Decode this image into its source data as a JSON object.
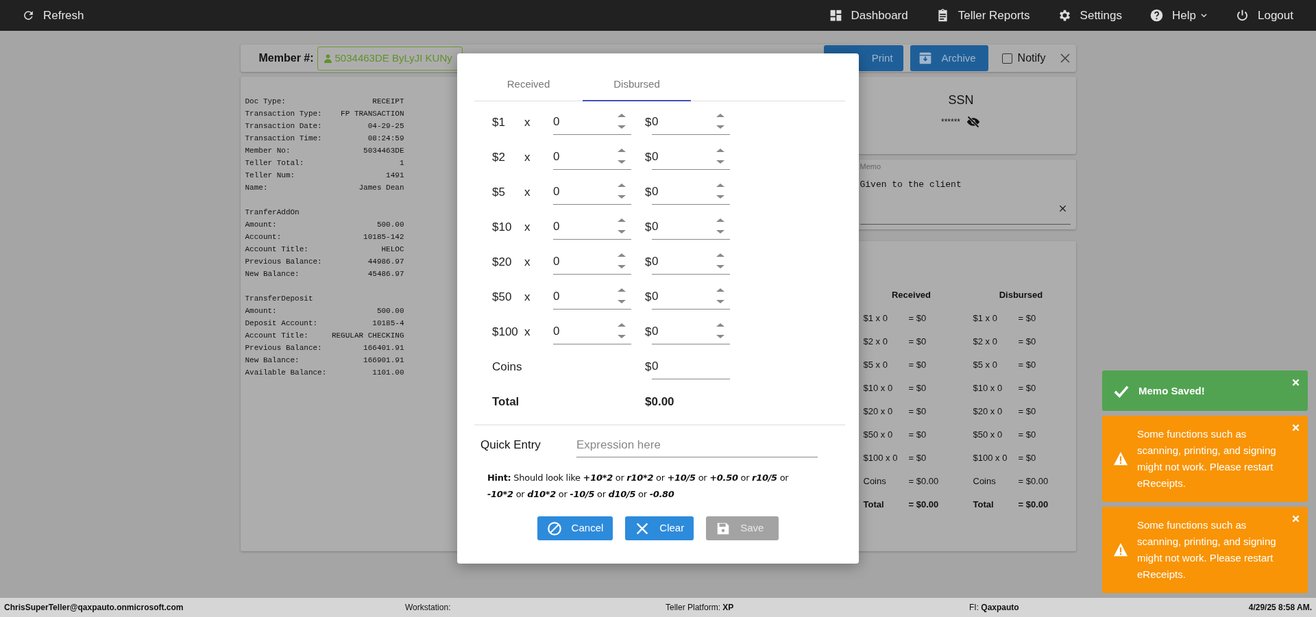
{
  "nav": {
    "refresh": "Refresh",
    "items": [
      {
        "label": "Dashboard",
        "has_menu": false
      },
      {
        "label": "Teller Reports",
        "has_menu": false
      },
      {
        "label": "Settings",
        "has_menu": false
      },
      {
        "label": "Help",
        "has_menu": true
      },
      {
        "label": "Logout",
        "has_menu": false
      }
    ]
  },
  "toolbar": {
    "member_label": "Member #:",
    "member_value": "5034463DE ByLyJI KUNy",
    "buttons": [
      {
        "label": "Print"
      },
      {
        "label": "Archive"
      }
    ],
    "notify": {
      "label": "Notify",
      "checked": false
    }
  },
  "receipt": {
    "sections": [
      {
        "lines": [
          {
            "label": "Doc Type:",
            "value": "RECEIPT"
          },
          {
            "label": "Transaction Type:",
            "value": "FP TRANSACTION"
          },
          {
            "label": "Transaction Date:",
            "value": "04-29-25"
          },
          {
            "label": "Transaction Time:",
            "value": "08:24:59"
          },
          {
            "label": "Member No:",
            "value": "5034463DE"
          },
          {
            "label": "Teller Total:",
            "value": "1"
          },
          {
            "label": "Teller Num:",
            "value": "1491"
          },
          {
            "label": "Name:",
            "value": "James Dean"
          }
        ]
      },
      {
        "heading": "TranferAddOn",
        "lines": [
          {
            "label": "Amount:",
            "value": "500.00"
          },
          {
            "label": "Account:",
            "value": "10185-142"
          },
          {
            "label": "Account Title:",
            "value": "HELOC"
          },
          {
            "label": "Previous Balance:",
            "value": "44986.97"
          },
          {
            "label": "New Balance:",
            "value": "45486.97"
          }
        ]
      },
      {
        "heading": "TransferDeposit",
        "lines": [
          {
            "label": "Amount:",
            "value": "500.00"
          },
          {
            "label": "Deposit Account:",
            "value": "10185-4"
          },
          {
            "label": "Account Title:",
            "value": "REGULAR CHECKING"
          },
          {
            "label": "Previous Balance:",
            "value": "166401.91"
          },
          {
            "label": "New Balance:",
            "value": "166901.91"
          },
          {
            "label": "Available Balance:",
            "value": "1101.00"
          }
        ]
      }
    ]
  },
  "ssn": {
    "label": "SSN",
    "value": "******",
    "hidden": true
  },
  "memo": {
    "label": "Memo",
    "value": "Given to the client"
  },
  "summary": {
    "columns": [
      {
        "title": "Received",
        "rows": [
          {
            "label": "$1 x 0",
            "value": "= $0",
            "kind": "line"
          },
          {
            "label": "$2 x 0",
            "value": "= $0",
            "kind": "line"
          },
          {
            "label": "$5 x 0",
            "value": "= $0",
            "kind": "line"
          },
          {
            "label": "$10 x 0",
            "value": "= $0",
            "kind": "line"
          },
          {
            "label": "$20 x 0",
            "value": "= $0",
            "kind": "line"
          },
          {
            "label": "$50 x 0",
            "value": "= $0",
            "kind": "line"
          },
          {
            "label": "$100 x 0",
            "value": "= $0",
            "kind": "line"
          },
          {
            "label": "Coins",
            "value": "= $0.00",
            "kind": "line"
          },
          {
            "label": "Total",
            "value": "= $0.00",
            "kind": "total"
          }
        ]
      },
      {
        "title": "Disbursed",
        "rows": [
          {
            "label": "$1 x 0",
            "value": "= $0",
            "kind": "line"
          },
          {
            "label": "$2 x 0",
            "value": "= $0",
            "kind": "line"
          },
          {
            "label": "$5 x 0",
            "value": "= $0",
            "kind": "line"
          },
          {
            "label": "$10 x 0",
            "value": "= $0",
            "kind": "line"
          },
          {
            "label": "$20 x 0",
            "value": "= $0",
            "kind": "line"
          },
          {
            "label": "$50 x 0",
            "value": "= $0",
            "kind": "line"
          },
          {
            "label": "$100 x 0",
            "value": "= $0",
            "kind": "line"
          },
          {
            "label": "Coins",
            "value": "= $0.00",
            "kind": "line"
          },
          {
            "label": "Total",
            "value": "= $0.00",
            "kind": "total"
          }
        ]
      }
    ]
  },
  "modal": {
    "tabs": [
      {
        "label": "Received",
        "selected": false
      },
      {
        "label": "Disbursed",
        "selected": true
      }
    ],
    "rows": [
      {
        "kind": "bill",
        "label": "$1",
        "times": "x",
        "count": "0",
        "currency": "$",
        "amount": "0"
      },
      {
        "kind": "bill",
        "label": "$2",
        "times": "x",
        "count": "0",
        "currency": "$",
        "amount": "0"
      },
      {
        "kind": "bill",
        "label": "$5",
        "times": "x",
        "count": "0",
        "currency": "$",
        "amount": "0"
      },
      {
        "kind": "bill",
        "label": "$10",
        "times": "x",
        "count": "0",
        "currency": "$",
        "amount": "0"
      },
      {
        "kind": "bill",
        "label": "$20",
        "times": "x",
        "count": "0",
        "currency": "$",
        "amount": "0"
      },
      {
        "kind": "bill",
        "label": "$50",
        "times": "x",
        "count": "0",
        "currency": "$",
        "amount": "0"
      },
      {
        "kind": "bill",
        "label": "$100",
        "times": "x",
        "count": "0",
        "currency": "$",
        "amount": "0"
      },
      {
        "kind": "coins",
        "label": "Coins",
        "currency": "$",
        "amount": "0"
      },
      {
        "kind": "total",
        "label": "Total",
        "amount": "$0.00"
      }
    ],
    "quick_entry": {
      "label": "Quick Entry",
      "placeholder": "Expression here"
    },
    "hint": [
      {
        "kind": "label",
        "text": "Hint:"
      },
      {
        "kind": "plain",
        "text": "Should look like"
      },
      {
        "kind": "example",
        "text": "+10*2"
      },
      {
        "kind": "plain",
        "text": "or"
      },
      {
        "kind": "example",
        "text": "r10*2"
      },
      {
        "kind": "plain",
        "text": "or"
      },
      {
        "kind": "example",
        "text": "+10/5"
      },
      {
        "kind": "plain",
        "text": "or"
      },
      {
        "kind": "example",
        "text": "+0.50"
      },
      {
        "kind": "plain",
        "text": "or"
      },
      {
        "kind": "example",
        "text": "r10/5"
      },
      {
        "kind": "plain",
        "text": "or"
      },
      {
        "kind": "example",
        "text": "-10*2"
      },
      {
        "kind": "plain",
        "text": "or"
      },
      {
        "kind": "example",
        "text": "d10*2"
      },
      {
        "kind": "plain",
        "text": "or"
      },
      {
        "kind": "example",
        "text": "-10/5"
      },
      {
        "kind": "plain",
        "text": "or"
      },
      {
        "kind": "example",
        "text": "d10/5"
      },
      {
        "kind": "plain",
        "text": "or"
      },
      {
        "kind": "example",
        "text": "-0.80"
      }
    ],
    "buttons": [
      {
        "label": "Cancel",
        "disabled": false
      },
      {
        "label": "Clear",
        "disabled": false
      },
      {
        "label": "Save",
        "disabled": true
      }
    ]
  },
  "toasts": [
    {
      "kind": "success",
      "text": "Memo Saved!"
    },
    {
      "kind": "warning",
      "text": "Some functions such as scanning, printing, and signing might not work. Please restart eReceipts."
    },
    {
      "kind": "warning",
      "text": "Some functions such as scanning, printing, and signing might not work. Please restart eReceipts."
    }
  ],
  "footer": {
    "user": "ChrisSuperTeller@qaxpauto.onmicrosoft.com",
    "workstation": "Workstation:",
    "platform": "Teller Platform: **XP**",
    "fi": "FI: **Qaxpauto**",
    "datetime": "4/29/25 8:58 AM."
  }
}
